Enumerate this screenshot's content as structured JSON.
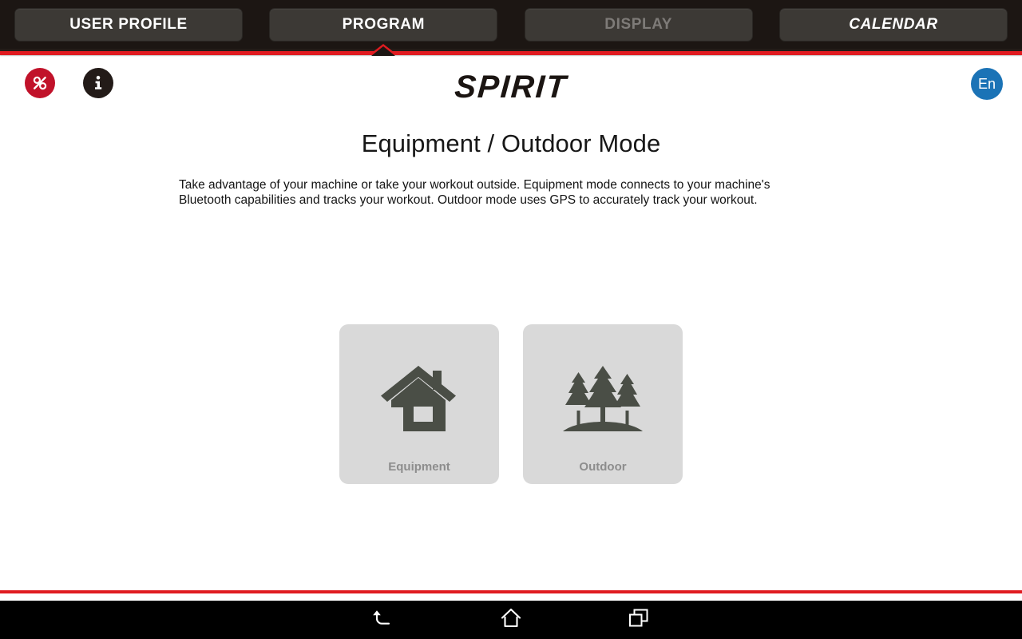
{
  "tabs": [
    {
      "id": "user-profile",
      "label": "USER PROFILE",
      "state": "normal"
    },
    {
      "id": "program",
      "label": "PROGRAM",
      "state": "active"
    },
    {
      "id": "display",
      "label": "DISPLAY",
      "state": "disabled"
    },
    {
      "id": "calendar",
      "label": "CALENDAR",
      "state": "italic"
    }
  ],
  "header": {
    "brand_logo_text": "SPIRIT",
    "left_icons": [
      {
        "name": "no-percent-icon",
        "glyph": "%",
        "color": "#c1122a"
      },
      {
        "name": "info-icon",
        "glyph": "i",
        "color": "#231b18"
      }
    ],
    "language_button": {
      "label": "En",
      "color": "#1b73b6"
    }
  },
  "main": {
    "title": "Equipment / Outdoor Mode",
    "description": "Take advantage of your machine or take your workout outside. Equipment mode connects to your machine's Bluetooth capabilities and tracks your workout. Outdoor mode uses GPS to accurately track your workout.",
    "mode_cards": [
      {
        "id": "equipment",
        "label": "Equipment",
        "icon": "house-icon"
      },
      {
        "id": "outdoor",
        "label": "Outdoor",
        "icon": "pine-trees-icon"
      }
    ]
  },
  "navbar": {
    "buttons": [
      {
        "id": "back",
        "icon": "back-arrow-icon"
      },
      {
        "id": "home",
        "icon": "home-outline-icon"
      },
      {
        "id": "recent",
        "icon": "recent-apps-icon"
      }
    ]
  },
  "theme": {
    "accent_red": "#e01b20",
    "tabbar_bg": "#1c1613",
    "tab_bg": "#3c3935",
    "card_bg": "#d9d9d9",
    "card_icon": "#4a4e46",
    "card_label": "#8d8d8d"
  }
}
